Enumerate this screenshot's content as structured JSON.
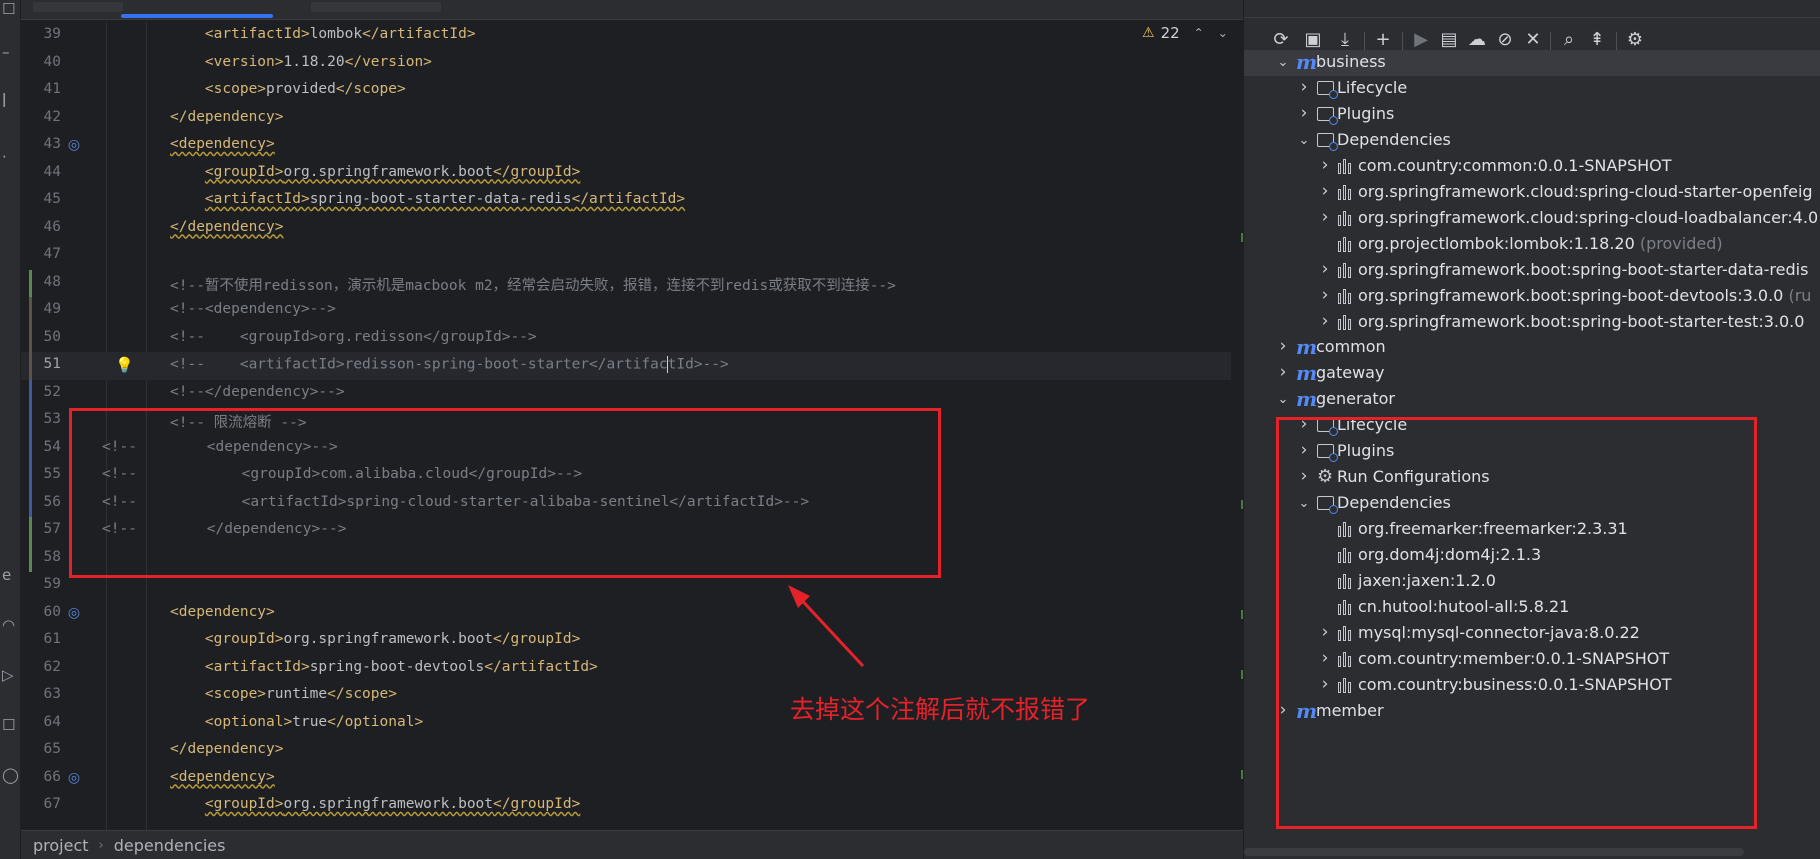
{
  "editor": {
    "inspection": {
      "warning_count": "22"
    },
    "lines": [
      {
        "n": "39",
        "segs": [
          [
            "    ",
            "tx"
          ],
          [
            "<artifactId>",
            "tg"
          ],
          [
            "lombok",
            "tx"
          ],
          [
            "</artifactId>",
            "tg"
          ]
        ]
      },
      {
        "n": "40",
        "segs": [
          [
            "    ",
            "tx"
          ],
          [
            "<version>",
            "tg"
          ],
          [
            "1.18.20",
            "tx"
          ],
          [
            "</version>",
            "tg"
          ]
        ]
      },
      {
        "n": "41",
        "segs": [
          [
            "    ",
            "tx"
          ],
          [
            "<scope>",
            "tg"
          ],
          [
            "provided",
            "tx"
          ],
          [
            "</scope>",
            "tg"
          ]
        ]
      },
      {
        "n": "42",
        "segs": [
          [
            "</dependency>",
            "tg"
          ]
        ]
      },
      {
        "n": "43",
        "segs": [
          [
            "<dependency>",
            "tg ul"
          ]
        ]
      },
      {
        "n": "44",
        "segs": [
          [
            "    ",
            "tx"
          ],
          [
            "<groupId>",
            "tg ul"
          ],
          [
            "org.springframework.boot",
            "tx ul"
          ],
          [
            "</groupId>",
            "tg ul"
          ]
        ]
      },
      {
        "n": "45",
        "segs": [
          [
            "    ",
            "tx"
          ],
          [
            "<artifactId>",
            "tg ul"
          ],
          [
            "spring-boot-starter-data-redis",
            "tx ul"
          ],
          [
            "</artifactId>",
            "tg ul"
          ]
        ]
      },
      {
        "n": "46",
        "segs": [
          [
            "</dependency>",
            "tg ul"
          ]
        ]
      },
      {
        "n": "47",
        "segs": []
      },
      {
        "n": "48",
        "segs": [
          [
            "<!--暂不使用redisson，演示机是macbook m2，经常会启动失败，报错，连接不到redis或获取不到连接-->",
            "cm"
          ]
        ]
      },
      {
        "n": "49",
        "segs": [
          [
            "<!--<dependency>-->",
            "cm"
          ]
        ]
      },
      {
        "n": "50",
        "segs": [
          [
            "<!--    <groupId>org.redisson</groupId>-->",
            "cm"
          ]
        ]
      },
      {
        "n": "51",
        "segs": [
          [
            "<!--    <artifactId>redisson-spring-boot-starter</artifac",
            "cm"
          ],
          [
            "|",
            "caret"
          ],
          [
            "tId>-->",
            "cm"
          ]
        ]
      },
      {
        "n": "52",
        "segs": [
          [
            "<!--</dependency>-->",
            "cm"
          ]
        ]
      },
      {
        "n": "53",
        "segs": [
          [
            "<!-- 限流熔断 -->",
            "cm"
          ]
        ]
      },
      {
        "n": "54",
        "segs": [
          [
            "<!--        <dependency>-->",
            "cm"
          ]
        ]
      },
      {
        "n": "55",
        "segs": [
          [
            "<!--            <groupId>com.alibaba.cloud</groupId>-->",
            "cm"
          ]
        ]
      },
      {
        "n": "56",
        "segs": [
          [
            "<!--            <artifactId>spring-cloud-starter-alibaba-sentinel</artifactId>-->",
            "cm"
          ]
        ]
      },
      {
        "n": "57",
        "segs": [
          [
            "<!--        </dependency>-->",
            "cm"
          ]
        ]
      },
      {
        "n": "58",
        "segs": []
      },
      {
        "n": "59",
        "segs": []
      },
      {
        "n": "60",
        "segs": [
          [
            "<dependency>",
            "tg"
          ]
        ]
      },
      {
        "n": "61",
        "segs": [
          [
            "    ",
            "tx"
          ],
          [
            "<groupId>",
            "tg"
          ],
          [
            "org.springframework.boot",
            "tx"
          ],
          [
            "</groupId>",
            "tg"
          ]
        ]
      },
      {
        "n": "62",
        "segs": [
          [
            "    ",
            "tx"
          ],
          [
            "<artifactId>",
            "tg"
          ],
          [
            "spring-boot-devtools",
            "tx"
          ],
          [
            "</artifactId>",
            "tg"
          ]
        ]
      },
      {
        "n": "63",
        "segs": [
          [
            "    ",
            "tx"
          ],
          [
            "<scope>",
            "tg"
          ],
          [
            "runtime",
            "tx"
          ],
          [
            "</scope>",
            "tg"
          ]
        ]
      },
      {
        "n": "64",
        "segs": [
          [
            "    ",
            "tx"
          ],
          [
            "<optional>",
            "tg"
          ],
          [
            "true",
            "tx"
          ],
          [
            "</optional>",
            "tg"
          ]
        ]
      },
      {
        "n": "65",
        "segs": [
          [
            "</dependency>",
            "tg"
          ]
        ]
      },
      {
        "n": "66",
        "segs": [
          [
            "<dependency>",
            "tg ul"
          ]
        ]
      },
      {
        "n": "67",
        "segs": [
          [
            "    ",
            "tx"
          ],
          [
            "<groupId>",
            "tg ul"
          ],
          [
            "org.springframework.boot",
            "tx ul"
          ],
          [
            "</groupId>",
            "tg ul"
          ]
        ]
      }
    ]
  },
  "breadcrumbs": [
    "project",
    "dependencies"
  ],
  "maven": {
    "tree": [
      {
        "label": "business",
        "icon": "module",
        "indent": 0,
        "chevron": "down",
        "selected": true
      },
      {
        "label": "Lifecycle",
        "icon": "folder",
        "indent": 1,
        "chevron": "right"
      },
      {
        "label": "Plugins",
        "icon": "folder",
        "indent": 1,
        "chevron": "right"
      },
      {
        "label": "Dependencies",
        "icon": "folder",
        "indent": 1,
        "chevron": "down"
      },
      {
        "label": "com.country:common:0.0.1-SNAPSHOT",
        "icon": "library",
        "indent": 2,
        "chevron": "right"
      },
      {
        "label": "org.springframework.cloud:spring-cloud-starter-openfeig",
        "icon": "library",
        "indent": 2,
        "chevron": "right"
      },
      {
        "label": "org.springframework.cloud:spring-cloud-loadbalancer:4.0",
        "icon": "library",
        "indent": 2,
        "chevron": "right"
      },
      {
        "label": "org.projectlombok:lombok:1.18.20",
        "suffix": " (provided)",
        "icon": "library",
        "indent": 2,
        "chevron": ""
      },
      {
        "label": "org.springframework.boot:spring-boot-starter-data-redis",
        "icon": "library",
        "indent": 2,
        "chevron": "right"
      },
      {
        "label": "org.springframework.boot:spring-boot-devtools:3.0.0",
        "suffix": " (ru",
        "icon": "library",
        "indent": 2,
        "chevron": "right"
      },
      {
        "label": "org.springframework.boot:spring-boot-starter-test:3.0.0",
        "icon": "library",
        "indent": 2,
        "chevron": "right"
      },
      {
        "label": "common",
        "icon": "module",
        "indent": 0,
        "chevron": "right"
      },
      {
        "label": "gateway",
        "icon": "module",
        "indent": 0,
        "chevron": "right"
      },
      {
        "label": "generator",
        "icon": "module",
        "indent": 0,
        "chevron": "down"
      },
      {
        "label": "Lifecycle",
        "icon": "folder",
        "indent": 1,
        "chevron": "right"
      },
      {
        "label": "Plugins",
        "icon": "folder",
        "indent": 1,
        "chevron": "right"
      },
      {
        "label": "Run Configurations",
        "icon": "gear",
        "indent": 1,
        "chevron": "right"
      },
      {
        "label": "Dependencies",
        "icon": "folder",
        "indent": 1,
        "chevron": "down"
      },
      {
        "label": "org.freemarker:freemarker:2.3.31",
        "icon": "library",
        "indent": 2,
        "chevron": ""
      },
      {
        "label": "org.dom4j:dom4j:2.1.3",
        "icon": "library",
        "indent": 2,
        "chevron": ""
      },
      {
        "label": "jaxen:jaxen:1.2.0",
        "icon": "library",
        "indent": 2,
        "chevron": ""
      },
      {
        "label": "cn.hutool:hutool-all:5.8.21",
        "icon": "library",
        "indent": 2,
        "chevron": ""
      },
      {
        "label": "mysql:mysql-connector-java:8.0.22",
        "icon": "library",
        "indent": 2,
        "chevron": "right"
      },
      {
        "label": "com.country:member:0.0.1-SNAPSHOT",
        "icon": "library",
        "indent": 2,
        "chevron": "right"
      },
      {
        "label": "com.country:business:0.0.1-SNAPSHOT",
        "icon": "library",
        "indent": 2,
        "chevron": "right"
      },
      {
        "label": "member",
        "icon": "module",
        "indent": 0,
        "chevron": "right"
      }
    ]
  },
  "annotation": {
    "text": "去掉这个注解后就不报错了",
    "color": "#e5222a"
  },
  "colors": {
    "tag": "#d5b778",
    "comment": "#7a7e85",
    "accent": "#3574f0",
    "maven_module": "#548af7"
  }
}
